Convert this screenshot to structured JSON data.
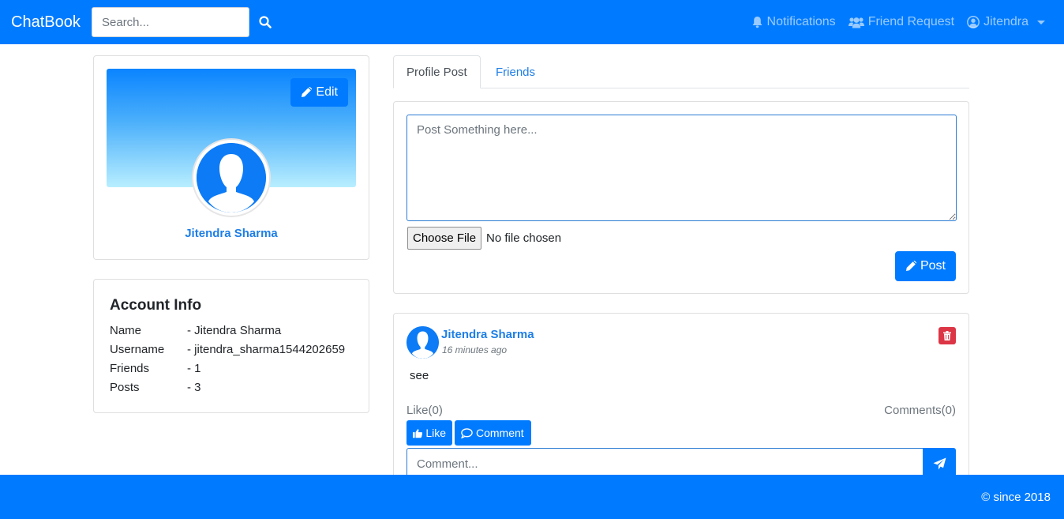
{
  "navbar": {
    "brand": "ChatBook",
    "search_placeholder": "Search...",
    "notifications_label": "Notifications",
    "friend_request_label": "Friend Request",
    "user_label": "Jitendra"
  },
  "profile": {
    "edit_label": "Edit",
    "name": "Jitendra Sharma"
  },
  "account_info": {
    "title": "Account Info",
    "rows": [
      {
        "key": "Name",
        "value": "- Jitendra Sharma"
      },
      {
        "key": "Username",
        "value": "- jitendra_sharma1544202659"
      },
      {
        "key": "Friends",
        "value": "- 1"
      },
      {
        "key": "Posts",
        "value": "- 3"
      }
    ]
  },
  "tabs": [
    {
      "label": "Profile Post",
      "active": true
    },
    {
      "label": "Friends",
      "active": false
    }
  ],
  "composer": {
    "placeholder": "Post Something here...",
    "choose_file_label": "Choose File",
    "no_file_label": "No file chosen",
    "post_label": "Post"
  },
  "feed": {
    "author": "Jitendra Sharma",
    "time": "16 minutes ago",
    "text": "see",
    "like_count": "Like(0)",
    "comment_count": "Comments(0)",
    "like_label": "Like",
    "comment_label": "Comment",
    "comment_placeholder": "Comment..."
  },
  "footer": {
    "text": "© since 2018"
  },
  "colors": {
    "primary": "#007bff",
    "link": "#1e7ee6",
    "danger": "#dc3545"
  },
  "icons": [
    "search-icon",
    "bell-icon",
    "users-icon",
    "user-circle-icon",
    "pencil-icon",
    "trash-icon",
    "thumbs-up-icon",
    "comment-icon",
    "paper-plane-icon"
  ]
}
